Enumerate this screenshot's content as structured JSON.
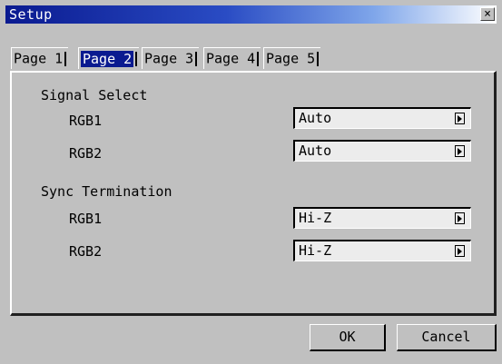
{
  "window": {
    "title": "Setup",
    "close_label": "×"
  },
  "tabs": [
    {
      "label": "Page 1",
      "selected": false
    },
    {
      "label": "Page 2",
      "selected": true
    },
    {
      "label": "Page 3",
      "selected": false
    },
    {
      "label": "Page 4",
      "selected": false
    },
    {
      "label": "Page 5",
      "selected": false
    }
  ],
  "signal_select": {
    "heading": "Signal Select",
    "rgb1": {
      "label": "RGB1",
      "value": "Auto"
    },
    "rgb2": {
      "label": "RGB2",
      "value": "Auto"
    }
  },
  "sync_termination": {
    "heading": "Sync Termination",
    "rgb1": {
      "label": "RGB1",
      "value": "Hi-Z"
    },
    "rgb2": {
      "label": "RGB2",
      "value": "Hi-Z"
    }
  },
  "buttons": {
    "ok": "OK",
    "cancel": "Cancel"
  },
  "colors": {
    "titlebar_start": "#0a1a90",
    "titlebar_end": "#ffffff",
    "selected_tab": "#0a1a90",
    "background": "#c0c0c0",
    "field": "#ececec"
  }
}
